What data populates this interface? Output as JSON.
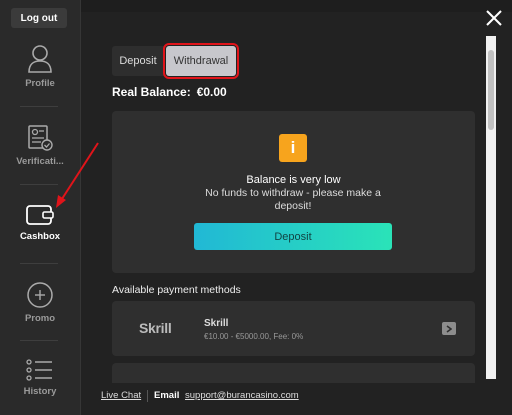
{
  "sidebar": {
    "logout_label": "Log out",
    "items": [
      {
        "label": "Profile",
        "icon": "user-icon",
        "active": false
      },
      {
        "label": "Verificati...",
        "icon": "verification-icon",
        "active": false
      },
      {
        "label": "Cashbox",
        "icon": "wallet-icon",
        "active": true
      },
      {
        "label": "Promo",
        "icon": "plus-circle-icon",
        "active": false
      },
      {
        "label": "History",
        "icon": "list-icon",
        "active": false
      }
    ]
  },
  "tabs": {
    "deposit_label": "Deposit",
    "withdrawal_label": "Withdrawal",
    "active": "Withdrawal"
  },
  "balance": {
    "label": "Real Balance:",
    "value": "€0.00"
  },
  "notice": {
    "icon_glyph": "i",
    "title": "Balance is very low",
    "message": "No funds to withdraw - please make a deposit!",
    "button_label": "Deposit"
  },
  "payment_methods": {
    "title": "Available payment methods",
    "items": [
      {
        "logo": "Skrill",
        "name": "Skrill",
        "details": "€10.00 - €5000.00, Fee: 0%"
      }
    ]
  },
  "footer": {
    "live_chat": "Live Chat",
    "email_label": "Email",
    "email": "support@burancasino.com"
  },
  "colors": {
    "highlight_border": "#e0141a",
    "warning": "#f7a41d",
    "deposit_gradient_start": "#21b8d5",
    "deposit_gradient_end": "#2ae3b8"
  }
}
